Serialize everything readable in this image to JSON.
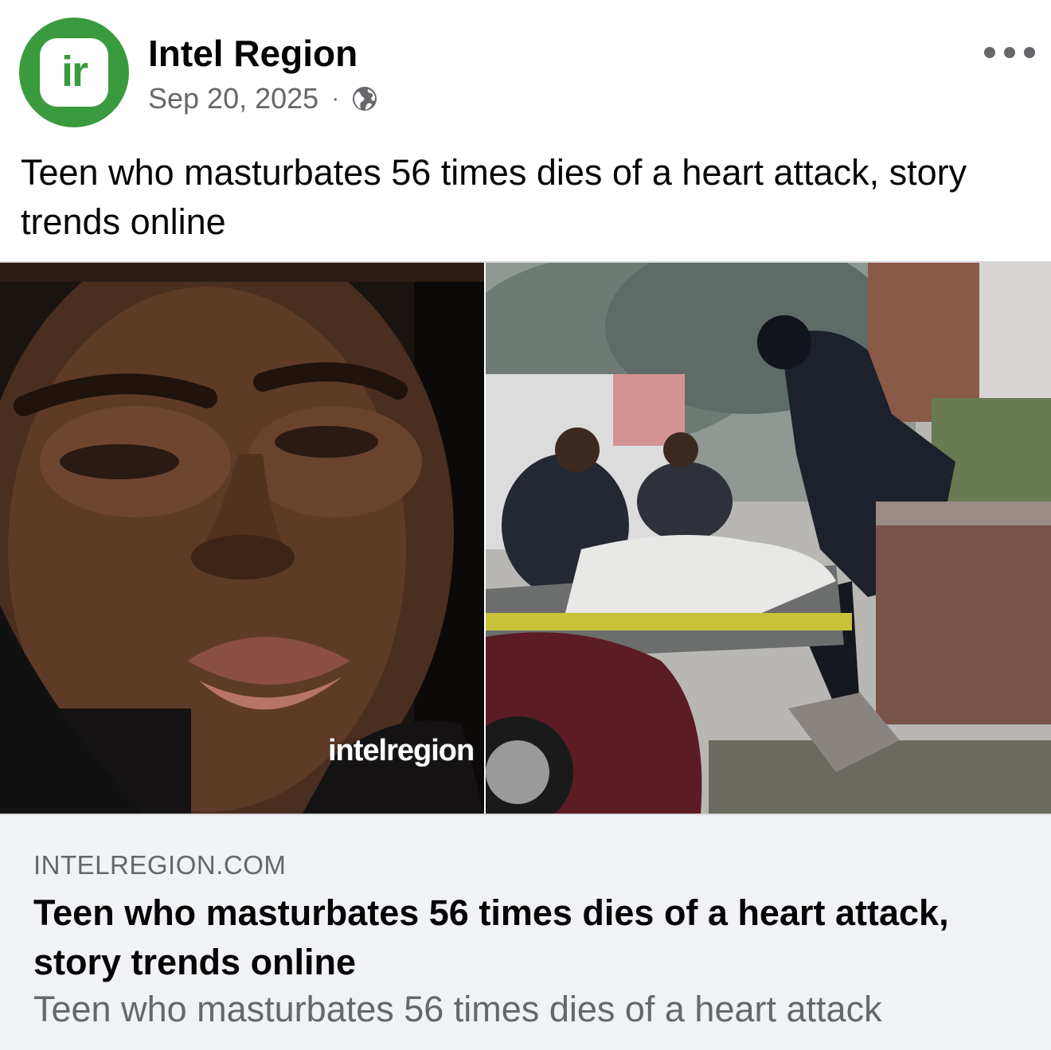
{
  "post": {
    "page_name": "Intel Region",
    "date": "Sep 20, 2025",
    "separator": "·",
    "avatar_letters": "ir",
    "audience_icon": "globe-icon",
    "more_icon": "more-options-icon",
    "text": "Teen who masturbates 56 times dies of a heart attack, story trends online"
  },
  "media": {
    "left_photo": "portrait-photo",
    "right_photo": "scene-photo",
    "watermark": "intelregion"
  },
  "link_preview": {
    "domain": "INTELREGION.COM",
    "title": "Teen who masturbates 56 times dies of a heart attack, story trends online",
    "description": "Teen who masturbates 56 times dies of a heart attack"
  },
  "colors": {
    "brand_green": "#3a9a3e",
    "secondary_text": "#65676b",
    "card_bg": "#f0f2f5"
  }
}
